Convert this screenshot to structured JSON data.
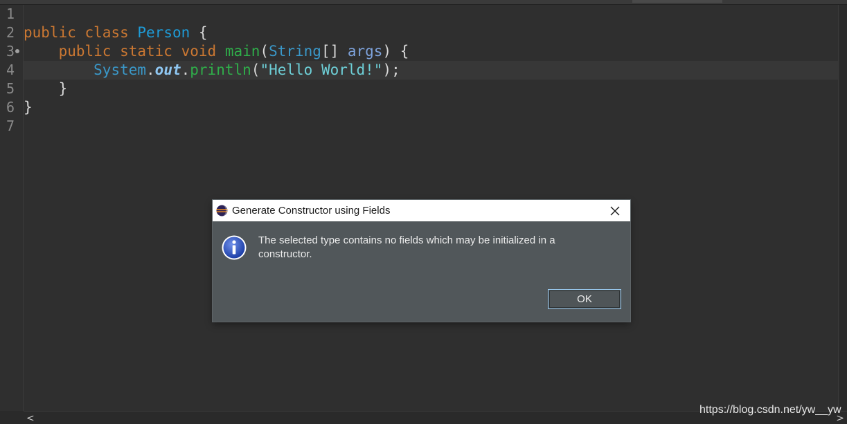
{
  "editor": {
    "line_numbers": [
      "1",
      "2",
      "3",
      "4",
      "5",
      "6",
      "7"
    ],
    "lines": {
      "l2": {
        "kw_public": "public",
        "kw_class": "class",
        "class_name": "Person",
        "brace": " {"
      },
      "l3": {
        "indent": "    ",
        "kw_public": "public",
        "kw_static": "static",
        "kw_void": "void",
        "method": "main",
        "paren_open": "(",
        "type_string": "String",
        "brackets": "[] ",
        "param": "args",
        "paren_close": ") {"
      },
      "l4": {
        "indent": "        ",
        "system": "System",
        "dot1": ".",
        "out": "out",
        "dot2": ".",
        "println": "println",
        "paren_open": "(",
        "string": "\"Hello World!\"",
        "end": ");"
      },
      "l5": {
        "indent": "    ",
        "brace": "}"
      },
      "l6": {
        "brace": "}"
      }
    },
    "colors": {
      "keyword": "#cc7832",
      "type": "#3a98c9",
      "method": "#2fae4a",
      "string": "#6ed0d8",
      "background": "#2f2f2f"
    }
  },
  "dialog": {
    "title": "Generate Constructor using Fields",
    "message": "The selected type contains no fields which may be initialized in a constructor.",
    "ok_label": "OK",
    "icon": "info-icon",
    "app_icon": "eclipse-icon",
    "close_icon": "close-icon"
  },
  "watermark": "https://blog.csdn.net/yw__yw",
  "scrollbar": {
    "left_arrow": "<",
    "right_arrow": ">"
  }
}
